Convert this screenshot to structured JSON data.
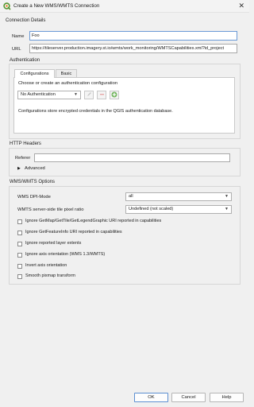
{
  "window": {
    "title": "Create a New WMS/WMTS Connection",
    "close_glyph": "✕"
  },
  "connection_details": {
    "title": "Connection Details",
    "name_label": "Name",
    "name_value": "Foo",
    "url_label": "URL",
    "url_value": "https://tileserver.production.imagery.st.io/wmts/work_monitoring/WMTSCapabilities.xml?id_project"
  },
  "authentication": {
    "title": "Authentication",
    "tabs": [
      "Configurations",
      "Basic"
    ],
    "active_tab": "Configurations",
    "choose_label": "Choose or create an authentication configuration",
    "config_selected": "No Authentication",
    "info_text": "Configurations store encrypted credentials in the QGIS authentication database."
  },
  "http_headers": {
    "title": "HTTP Headers",
    "referer_label": "Referer",
    "referer_value": "",
    "advanced_label": "Advanced"
  },
  "wms_options": {
    "title": "WMS/WMTS Options",
    "dpi_label": "WMS DPI-Mode",
    "dpi_value": "all",
    "tile_ratio_label": "WMTS server-side tile pixel ratio",
    "tile_ratio_value": "Undefined (not scaled)",
    "checkboxes": [
      "Ignore GetMap/GetTile/GetLegendGraphic URI reported in capabilities",
      "Ignore GetFeatureInfo URI reported in capabilities",
      "Ignore reported layer extents",
      "Ignore axis orientation (WMS 1.3/WMTS)",
      "Invert axis orientation",
      "Smooth pixmap transform"
    ]
  },
  "buttons": {
    "ok": "OK",
    "cancel": "Cancel",
    "help": "Help"
  },
  "icons": {
    "app": "qgis-logo-icon",
    "edit": "pencil-icon",
    "remove": "remove-icon",
    "add": "add-icon",
    "expand": "triangle-right-icon"
  },
  "colors": {
    "qgis_green": "#589632",
    "qgis_yellow": "#ee7913",
    "focus_border": "#6b9ad6"
  }
}
